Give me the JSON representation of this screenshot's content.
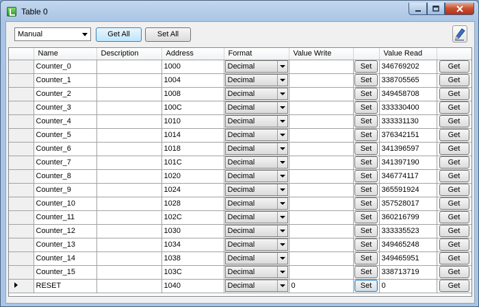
{
  "window": {
    "title": "Table 0"
  },
  "toolbar": {
    "mode_value": "Manual",
    "get_all_label": "Get All",
    "set_all_label": "Set All"
  },
  "table": {
    "columns": [
      "Name",
      "Description",
      "Address",
      "Format",
      "Value Write",
      "",
      "Value Read",
      ""
    ],
    "rows": [
      {
        "name": "Counter_0",
        "description": "",
        "address": "1000",
        "format": "Decimal",
        "value_write": "",
        "set": "Set",
        "value_read": "346769202",
        "get": "Get"
      },
      {
        "name": "Counter_1",
        "description": "",
        "address": "1004",
        "format": "Decimal",
        "value_write": "",
        "set": "Set",
        "value_read": "338705565",
        "get": "Get"
      },
      {
        "name": "Counter_2",
        "description": "",
        "address": "1008",
        "format": "Decimal",
        "value_write": "",
        "set": "Set",
        "value_read": "349458708",
        "get": "Get"
      },
      {
        "name": "Counter_3",
        "description": "",
        "address": "100C",
        "format": "Decimal",
        "value_write": "",
        "set": "Set",
        "value_read": "333330400",
        "get": "Get"
      },
      {
        "name": "Counter_4",
        "description": "",
        "address": "1010",
        "format": "Decimal",
        "value_write": "",
        "set": "Set",
        "value_read": "333331130",
        "get": "Get"
      },
      {
        "name": "Counter_5",
        "description": "",
        "address": "1014",
        "format": "Decimal",
        "value_write": "",
        "set": "Set",
        "value_read": "376342151",
        "get": "Get"
      },
      {
        "name": "Counter_6",
        "description": "",
        "address": "1018",
        "format": "Decimal",
        "value_write": "",
        "set": "Set",
        "value_read": "341396597",
        "get": "Get"
      },
      {
        "name": "Counter_7",
        "description": "",
        "address": "101C",
        "format": "Decimal",
        "value_write": "",
        "set": "Set",
        "value_read": "341397190",
        "get": "Get"
      },
      {
        "name": "Counter_8",
        "description": "",
        "address": "1020",
        "format": "Decimal",
        "value_write": "",
        "set": "Set",
        "value_read": "346774117",
        "get": "Get"
      },
      {
        "name": "Counter_9",
        "description": "",
        "address": "1024",
        "format": "Decimal",
        "value_write": "",
        "set": "Set",
        "value_read": "365591924",
        "get": "Get"
      },
      {
        "name": "Counter_10",
        "description": "",
        "address": "1028",
        "format": "Decimal",
        "value_write": "",
        "set": "Set",
        "value_read": "357528017",
        "get": "Get"
      },
      {
        "name": "Counter_11",
        "description": "",
        "address": "102C",
        "format": "Decimal",
        "value_write": "",
        "set": "Set",
        "value_read": "360216799",
        "get": "Get"
      },
      {
        "name": "Counter_12",
        "description": "",
        "address": "1030",
        "format": "Decimal",
        "value_write": "",
        "set": "Set",
        "value_read": "333335523",
        "get": "Get"
      },
      {
        "name": "Counter_13",
        "description": "",
        "address": "1034",
        "format": "Decimal",
        "value_write": "",
        "set": "Set",
        "value_read": "349465248",
        "get": "Get"
      },
      {
        "name": "Counter_14",
        "description": "",
        "address": "1038",
        "format": "Decimal",
        "value_write": "",
        "set": "Set",
        "value_read": "349465951",
        "get": "Get"
      },
      {
        "name": "Counter_15",
        "description": "",
        "address": "103C",
        "format": "Decimal",
        "value_write": "",
        "set": "Set",
        "value_read": "338713719",
        "get": "Get"
      },
      {
        "name": "RESET",
        "description": "",
        "address": "1040",
        "format": "Decimal",
        "value_write": "0",
        "set": "Set",
        "value_read": "0",
        "get": "Get"
      }
    ]
  }
}
